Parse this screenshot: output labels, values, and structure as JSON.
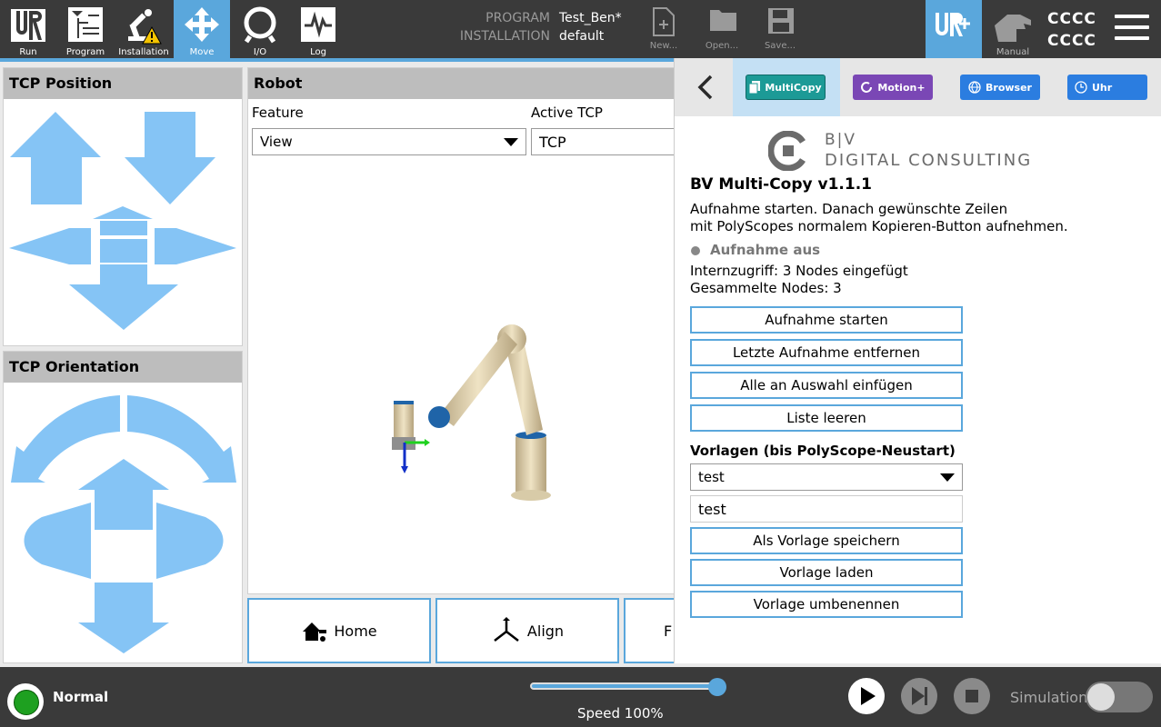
{
  "nav": {
    "items": [
      {
        "label": "Run"
      },
      {
        "label": "Program"
      },
      {
        "label": "Installation"
      },
      {
        "label": "Move"
      },
      {
        "label": "I/O"
      },
      {
        "label": "Log"
      }
    ]
  },
  "header": {
    "program_label": "PROGRAM",
    "program_value": "Test_Ben*",
    "installation_label": "INSTALLATION",
    "installation_value": "default",
    "new_label": "New...",
    "open_label": "Open...",
    "save_label": "Save...",
    "manual_label": "Manual",
    "user_line1": "CCCC",
    "user_line2": "CCCC"
  },
  "tcp_position": {
    "title": "TCP Position"
  },
  "tcp_orientation": {
    "title": "TCP Orientation"
  },
  "robot": {
    "title": "Robot",
    "feature_label": "Feature",
    "feature_value": "View",
    "active_tcp_label": "Active TCP",
    "active_tcp_value": "TCP",
    "home_label": "Home",
    "align_label": "Align",
    "third_label": "F"
  },
  "side": {
    "tabs": [
      {
        "label": "MultiCopy",
        "color": "#1c9a96"
      },
      {
        "label": "Motion+",
        "color": "#7a47b5"
      },
      {
        "label": "Browser",
        "color": "#2b7de0"
      },
      {
        "label": "Uhr",
        "color": "#2b7de0"
      }
    ],
    "logo_line1": "B|V",
    "logo_line2": "DIGITAL CONSULTING",
    "title": "BV Multi-Copy  v1.1.1",
    "desc_line1": "Aufnahme starten. Danach gewünschte Zeilen",
    "desc_line2": "mit PolyScopes normalem Kopieren-Button aufnehmen.",
    "rec_status": "Aufnahme aus",
    "intern_access": "Internzugriff: 3 Nodes eingefügt",
    "collected": "Gesammelte Nodes: 3",
    "btn_start": "Aufnahme starten",
    "btn_remove_last": "Letzte Aufnahme entfernen",
    "btn_insert_all": "Alle an Auswahl einfügen",
    "btn_clear": "Liste leeren",
    "templates_title": "Vorlagen (bis PolyScope-Neustart)",
    "template_selected": "test",
    "template_name": "test",
    "btn_save_template": "Als Vorlage speichern",
    "btn_load_template": "Vorlage laden",
    "btn_rename_template": "Vorlage umbenennen"
  },
  "footer": {
    "status": "Normal",
    "speed_label": "Speed 100%",
    "speed_percent": 100,
    "simulation_label": "Simulation",
    "simulation_on": false
  },
  "colors": {
    "accent": "#5aa7dc",
    "arrow": "#85c4f5",
    "status_green": "#1ea020"
  }
}
